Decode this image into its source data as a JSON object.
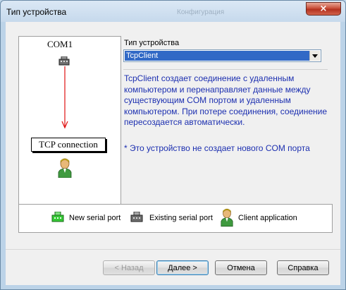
{
  "window": {
    "title": "Тип устройства",
    "ghost_title": "Конфигурация",
    "close_glyph": "×"
  },
  "diagram": {
    "com_label": "COM1",
    "tcp_label": "TCP connection",
    "arrow_color": "#e01010"
  },
  "device_type": {
    "label": "Тип устройства",
    "selected": "TcpClient"
  },
  "description": {
    "text": "TcpClient создает соединение с удаленным компьютером и перенаправляет данные между существующим COM портом и удаленным компьютером. При потере соединения, соединение пересоздается автоматически.",
    "note": "* Это устройство не создает нового COM порта"
  },
  "legend": {
    "new_serial_port": "New serial port",
    "existing_serial_port": "Existing serial port",
    "client_application": "Client application"
  },
  "buttons": {
    "back": "< Назад",
    "next": "Далее >",
    "cancel": "Отмена",
    "help": "Справка"
  },
  "colors": {
    "text_blue": "#1c2fb0",
    "selection": "#3169c6",
    "new_port_green": "#35c935"
  }
}
